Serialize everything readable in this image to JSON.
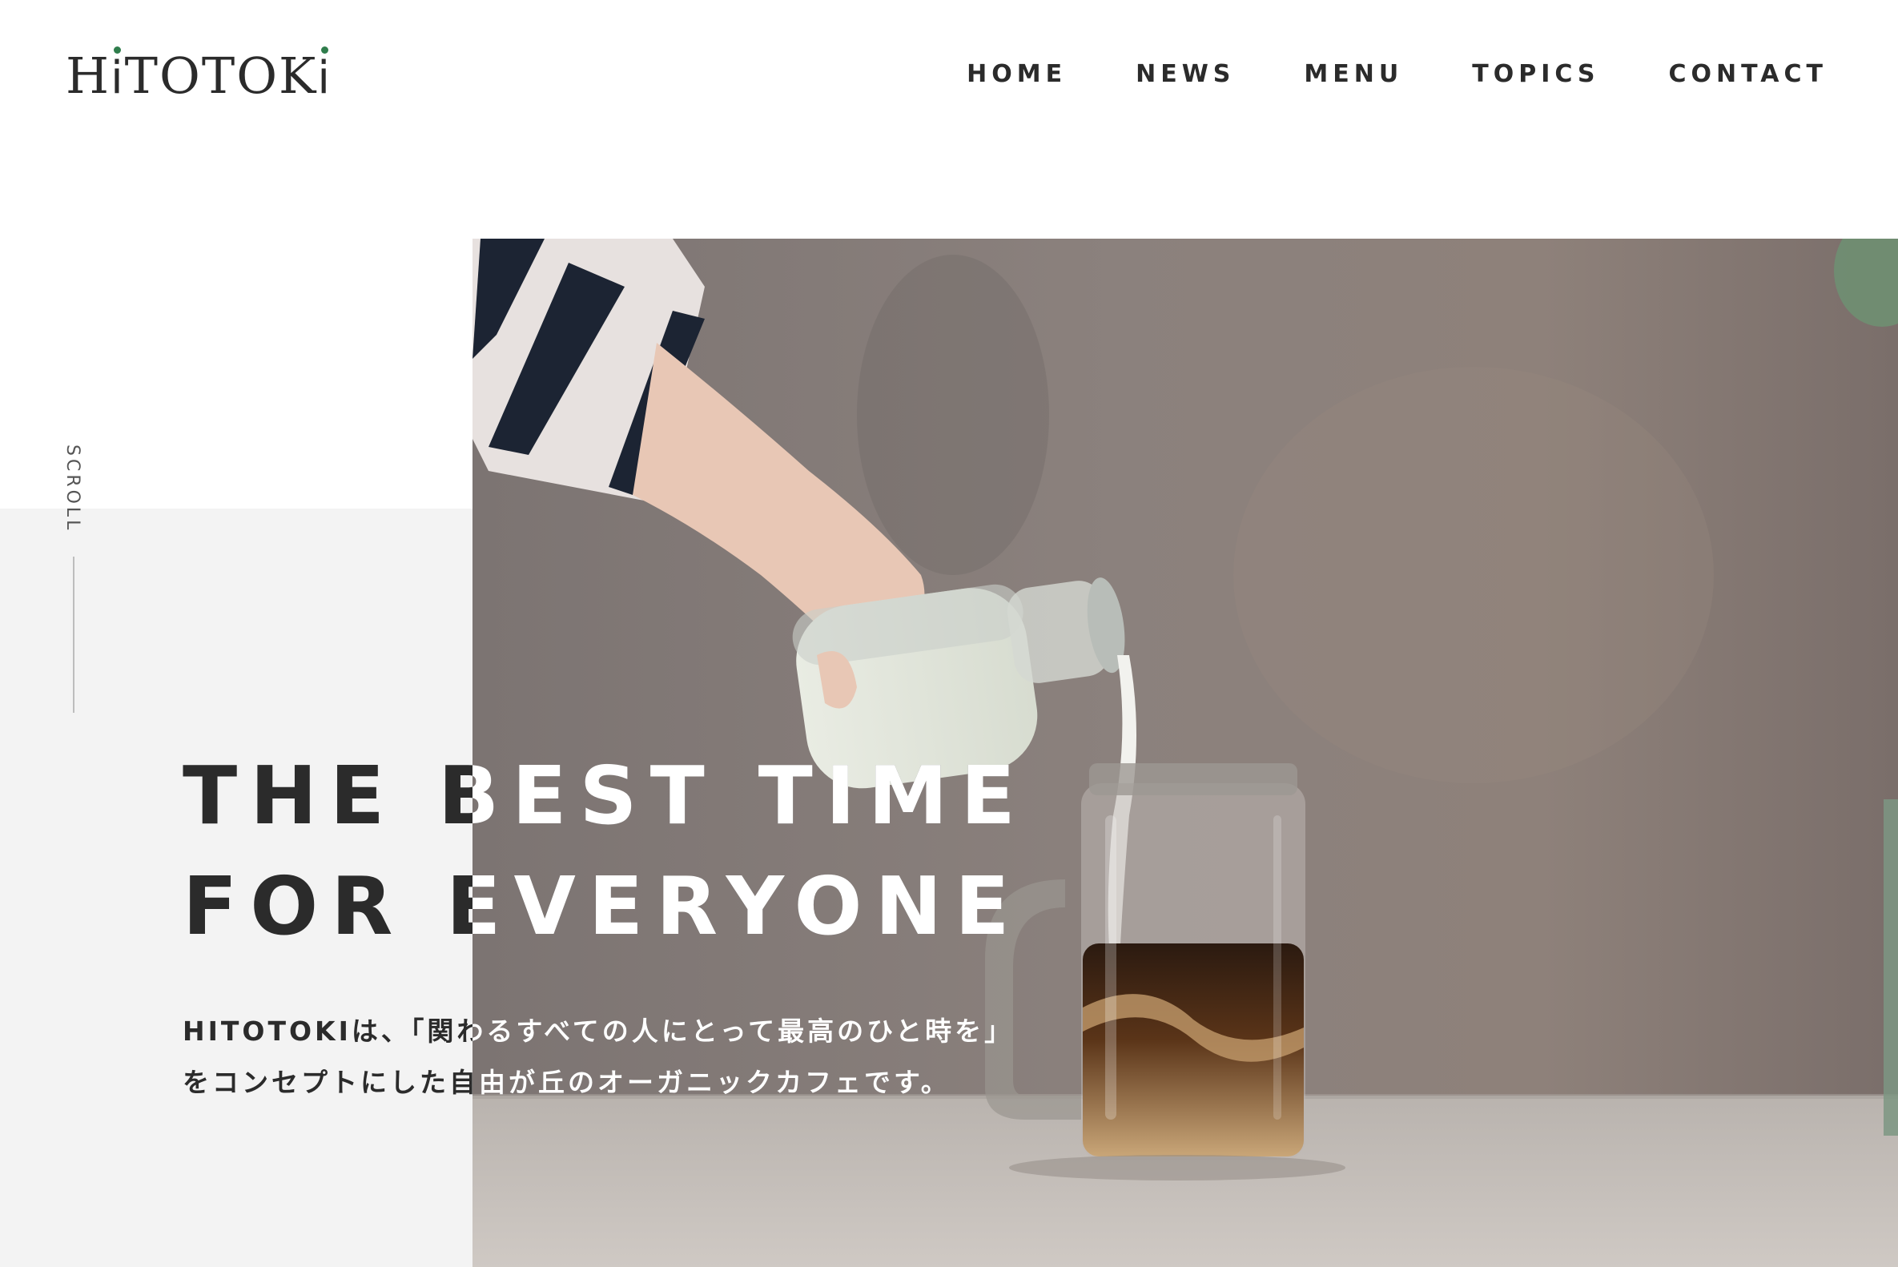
{
  "header": {
    "logo_text": "HITOTOKI",
    "logo_letters": [
      "H",
      "i",
      "T",
      "O",
      "T",
      "O",
      "K",
      "i"
    ],
    "nav": [
      {
        "label": "HOME"
      },
      {
        "label": "NEWS"
      },
      {
        "label": "MENU"
      },
      {
        "label": "TOPICS"
      },
      {
        "label": "CONTACT"
      }
    ]
  },
  "scroll": {
    "label": "SCROLL"
  },
  "hero": {
    "headline_line1": "THE BEST TIME",
    "headline_line2": "FOR EVERYONE",
    "copy_line1": "HITOTOKIは、「関わるすべての人にとって最高のひと時を」",
    "copy_line2": "をコンセプトにした自由が丘のオーガニックカフェです。",
    "photo_subject": "hand-pouring-milk-into-iced-coffee-jar"
  },
  "colors": {
    "text": "#2b2b2b",
    "accent": "#2f7d4c",
    "panel": "#f3f3f3",
    "background": "#ffffff"
  }
}
